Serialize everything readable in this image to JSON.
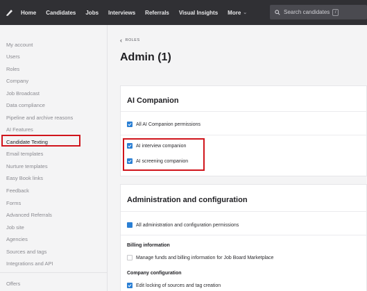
{
  "topnav": {
    "items": [
      "Home",
      "Candidates",
      "Jobs",
      "Interviews",
      "Referrals",
      "Visual Insights",
      "More"
    ],
    "search_placeholder": "Search candidates",
    "search_shortcut": "/"
  },
  "sidebar": {
    "items": [
      "My account",
      "Users",
      "Roles",
      "Company",
      "Job Broadcast",
      "Data compliance",
      "Pipeline and archive reasons",
      "AI Features",
      "Candidate Texting",
      "Email templates",
      "Nurture templates",
      "Easy Book links",
      "Feedback",
      "Forms",
      "Advanced Referrals",
      "Job site",
      "Agencies",
      "Sources and tags",
      "Integrations and API"
    ],
    "bottom_items": [
      "Offers"
    ],
    "active_item": "Candidate Texting"
  },
  "main": {
    "breadcrumb": "ROLES",
    "title": "Admin (1)",
    "ai_companion": {
      "title": "AI Companion",
      "all_label": "All AI Companion permissions",
      "items": [
        "AI interview companion",
        "AI screening companion"
      ]
    },
    "admin_config": {
      "title": "Administration and configuration",
      "all_label": "All administration and configuration permissions",
      "billing_label": "Billing information",
      "billing_items": [
        "Manage funds and billing information for Job Board Marketplace"
      ],
      "company_label": "Company configuration",
      "company_items": [
        "Edit locking of sources and tag creation"
      ]
    }
  },
  "colors": {
    "nav_bg": "#303034",
    "checkbox": "#2a7fd4",
    "highlight": "#d0141b"
  }
}
